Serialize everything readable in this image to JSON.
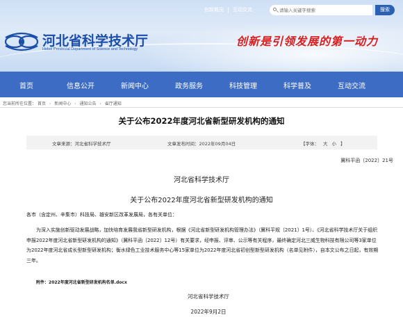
{
  "header": {
    "util_links": [
      "创新概况",
      "互动交流"
    ],
    "search_placeholder": "请输入关键字搜索",
    "search_button": "搜索",
    "site_title": "河北省科学技术厅",
    "site_subtitle": "Hebei Provincial Department of Science and Technology",
    "slogan": "创新是引领发展的第一动力"
  },
  "nav": {
    "items": [
      "首页",
      "信息公开",
      "新闻中心",
      "政务服务",
      "科技管理",
      "科学普及",
      "互动交流"
    ]
  },
  "breadcrumb": {
    "prefix": "您当前所在位置：",
    "items": [
      "首页",
      "新闻中心",
      "通知公告",
      "省厅通知"
    ]
  },
  "article": {
    "title": "关于公布2022年度河北省新型研发机构的通知",
    "meta": {
      "source": "文章来源：河北省科学技术厅",
      "date": "文章发布时间：2022年09月04日",
      "font_label": "【字体：",
      "font_large": "大",
      "font_small": "小",
      "font_end": "】"
    },
    "doc_number": "冀科平函〔2022〕21号",
    "issuer": "河北省科学技术厅",
    "subtitle": "关于公布2022年度河北省新型研发机构的通知",
    "addressee": "各市（含定州、辛集市）科技局、雄安新区改革发展局，各有关单位：",
    "body": "为深入实施创新驱动发展战略，加快培育发展我省新型研发机构，根据《河北省新型研发机构管理办法》（冀科平规〔2021〕1号）、《河北省科学技术厅关于组织申报2022年度河北省新型研发机构的通知》（冀科平函〔2022〕12号）有关要求，经申报、评审、公示等有关程序，最终确定河北三威生物科技有限公司等3家单位为2022年度河北省成长型新型研发机构；衡水绿色工业技术服务中心等15家单位为2022年度河北省初创型新型研发机构（名单见附件），自本文公布之日起，有效期三年。",
    "attachment_label": "附件：",
    "attachment_file": "2022年度河北省新型研发机构名单.docx",
    "signature": "河北省科学技术厅",
    "sign_date": "2022年9月2日"
  },
  "colors": {
    "nav_bg": "#3d6cc4",
    "brand_blue": "#1a4ea8",
    "slogan_red": "#d81e1e",
    "search_btn": "#2a61b3"
  }
}
